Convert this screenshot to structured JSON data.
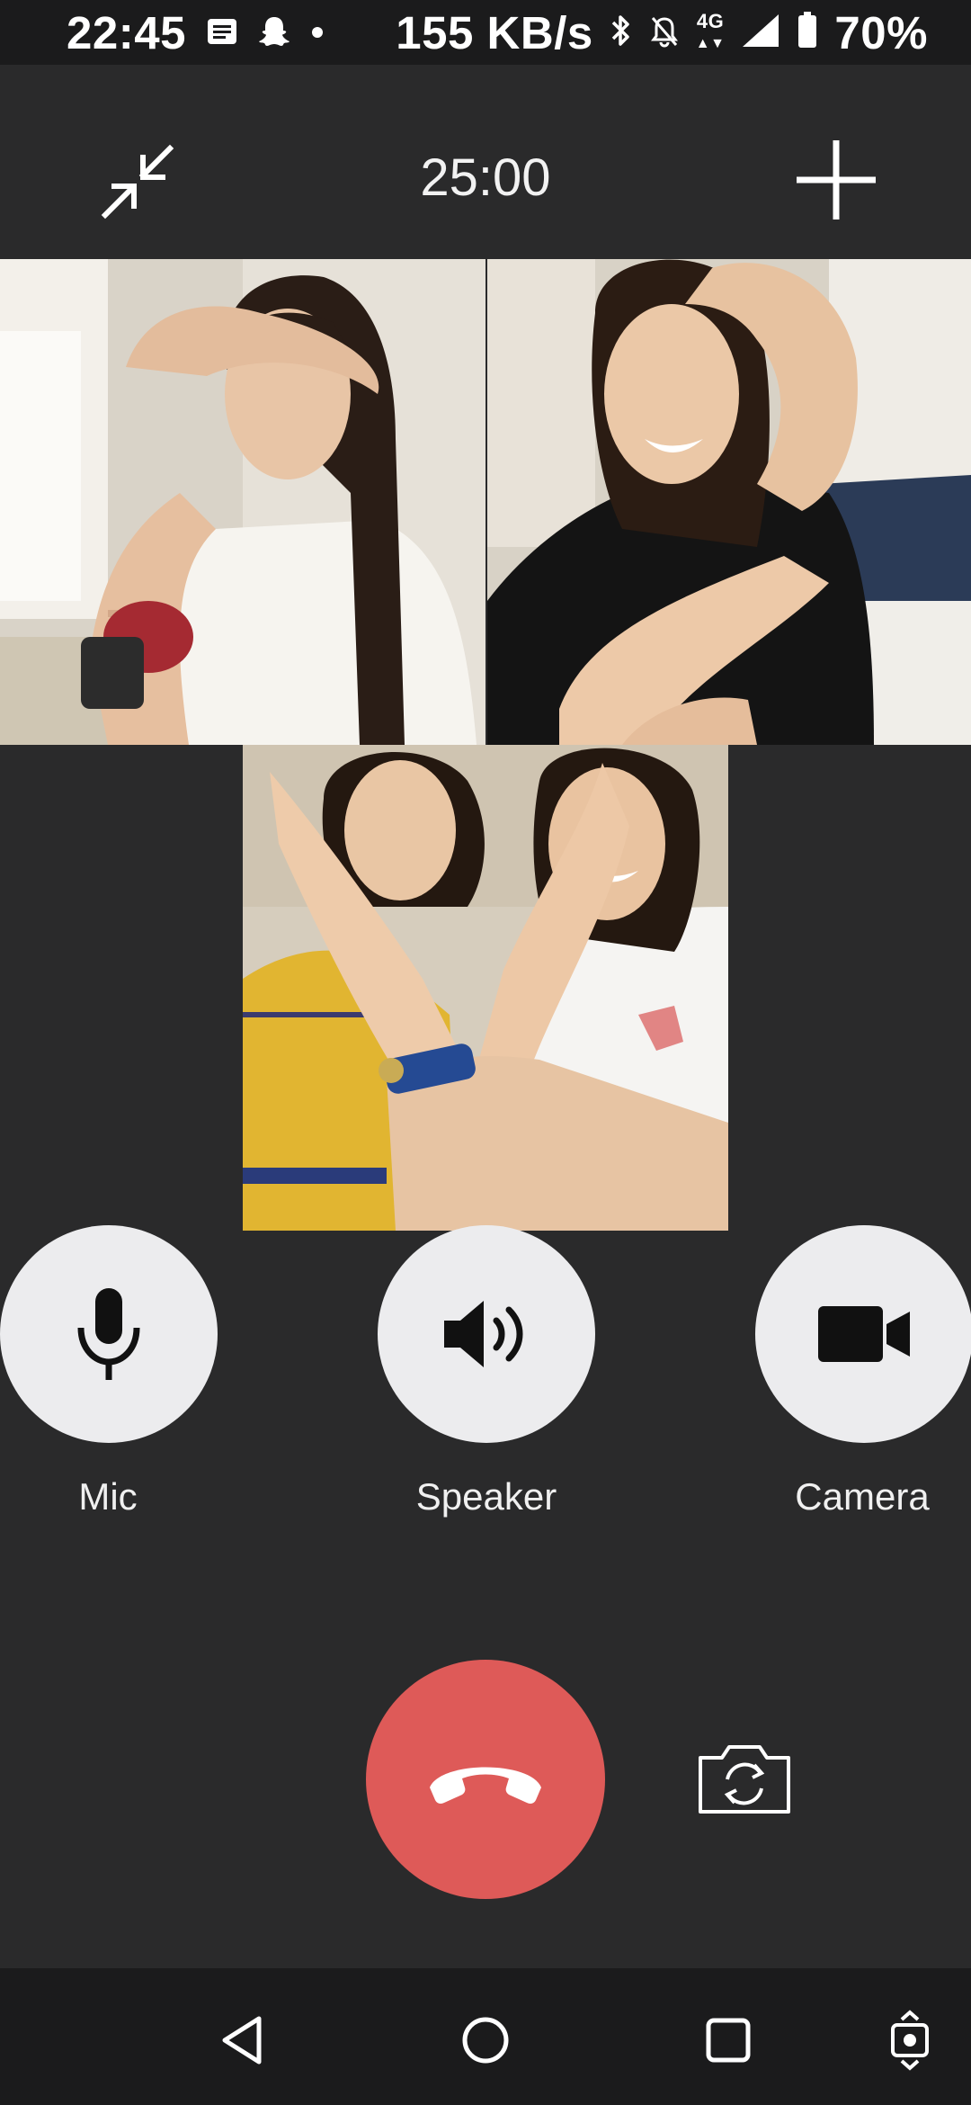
{
  "status_bar": {
    "time": "22:45",
    "network_speed": "155 KB/s",
    "network_type": "4G",
    "battery": "70%",
    "icons": [
      "message-icon",
      "snapchat-icon",
      "dot-icon",
      "bluetooth-icon",
      "mute-icon",
      "signal-icon",
      "battery-icon"
    ]
  },
  "call": {
    "timer": "25:00",
    "icons": [
      "minimize-icon",
      "add-icon"
    ]
  },
  "participants": [
    {
      "tile": "video-tile-1",
      "description": "participant video"
    },
    {
      "tile": "video-tile-2",
      "description": "participant video"
    },
    {
      "tile": "video-tile-3",
      "description": "participant video"
    }
  ],
  "controls": {
    "mic_label": "Mic",
    "speaker_label": "Speaker",
    "camera_label": "Camera",
    "end_call_color": "#de5a58",
    "icons": [
      "microphone-icon",
      "speaker-icon",
      "video-camera-icon",
      "hang-up-icon",
      "switch-camera-icon"
    ]
  },
  "nav_bar": {
    "icons": [
      "back-icon",
      "home-icon",
      "recents-icon",
      "rotate-icon"
    ]
  },
  "colors": {
    "background": "#2a2a2b",
    "bars": "#1b1b1c",
    "control_button": "#ececee",
    "end_call": "#de5a58"
  }
}
